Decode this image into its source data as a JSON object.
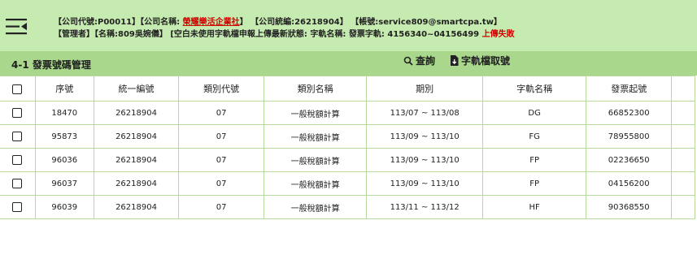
{
  "header": {
    "line1": {
      "company_code": "【公司代號:P00011】",
      "company_name_label": "【公司名稱: ",
      "company_name_value": "榮耀樂活企業社",
      "company_name_close": "】",
      "tax_id": "【公司統編:26218904】",
      "account": "【帳號:service809@smartcpa.tw】"
    },
    "line2": {
      "manager": "【管理者】【名稱:809吳婉儀】",
      "status_label": "[空白未使用字軌檔申報上傳最新狀態: 字軌名稱: 發票字軌: 4156340~04156499 ",
      "status_value": "上傳失敗"
    }
  },
  "title_bar": {
    "page_title": "4-1 發票號碼管理",
    "query_label": "查詢",
    "fetch_label": "字軌檔取號"
  },
  "table": {
    "columns": [
      "序號",
      "統一編號",
      "類別代號",
      "類別名稱",
      "期別",
      "字軌名稱",
      "發票起號"
    ],
    "rows": [
      [
        "18470",
        "26218904",
        "07",
        "一般稅額計算",
        "113/07 ~ 113/08",
        "DG",
        "66852300"
      ],
      [
        "95873",
        "26218904",
        "07",
        "一般稅額計算",
        "113/09 ~ 113/10",
        "FG",
        "78955800"
      ],
      [
        "96036",
        "26218904",
        "07",
        "一般稅額計算",
        "113/09 ~ 113/10",
        "FP",
        "02236650"
      ],
      [
        "96037",
        "26218904",
        "07",
        "一般稅額計算",
        "113/09 ~ 113/10",
        "FP",
        "04156200"
      ],
      [
        "96039",
        "26218904",
        "07",
        "一般稅額計算",
        "113/11 ~ 113/12",
        "HF",
        "90368550"
      ]
    ]
  },
  "colors": {
    "header_bg": "#c6ebb0",
    "title_bar_bg": "#a9d88c",
    "grid_line": "#b7d9a0",
    "error_red": "#d40000"
  },
  "icons": {
    "menu": "menu-collapse-icon",
    "query": "search-icon",
    "fetch": "file-download-icon"
  }
}
